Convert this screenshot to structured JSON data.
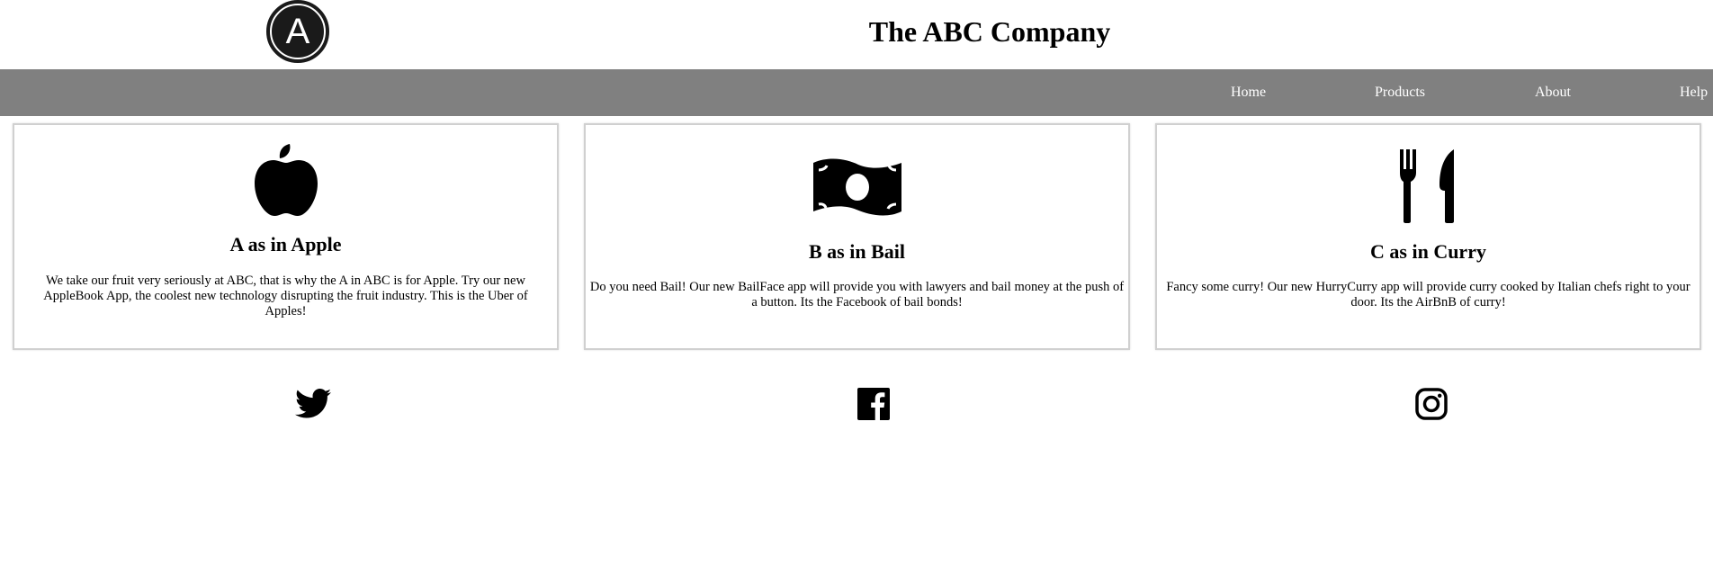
{
  "header": {
    "logo_letter": "A",
    "title": "The ABC Company"
  },
  "nav": {
    "items": [
      {
        "label": "Home"
      },
      {
        "label": "Products"
      },
      {
        "label": "About"
      },
      {
        "label": "Help"
      }
    ],
    "background_color": "#808080",
    "text_color": "#ffffff"
  },
  "cards": [
    {
      "icon": "apple-icon",
      "title": "A as in Apple",
      "text": "We take our fruit very seriously at ABC, that is why the A in ABC is for Apple. Try our new AppleBook App, the coolest new technology disrupting the fruit industry. This is the Uber of Apples!"
    },
    {
      "icon": "money-bill-icon",
      "title": "B as in Bail",
      "text": "Do you need Bail! Our new BailFace app will provide you with lawyers and bail money at the push of a button. Its the Facebook of bail bonds!"
    },
    {
      "icon": "utensils-icon",
      "title": "C as in Curry",
      "text": "Fancy some curry! Our new HurryCurry app will provide curry cooked by Italian chefs right to your door. Its the AirBnB of curry!"
    }
  ],
  "social": [
    {
      "icon": "twitter-icon"
    },
    {
      "icon": "facebook-icon"
    },
    {
      "icon": "instagram-icon"
    }
  ]
}
